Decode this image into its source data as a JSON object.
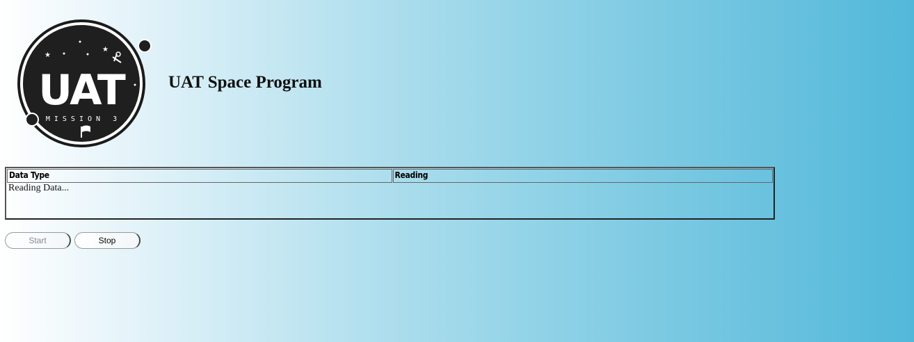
{
  "header": {
    "title": "UAT Space Program",
    "logo": {
      "main_text": "UAT",
      "sub_text": "M I S S I O N   3"
    }
  },
  "table": {
    "columns": [
      "Data Type",
      "Reading"
    ],
    "status": "Reading Data..."
  },
  "controls": {
    "start_label": "Start",
    "stop_label": "Stop",
    "start_enabled": false,
    "stop_enabled": true
  }
}
